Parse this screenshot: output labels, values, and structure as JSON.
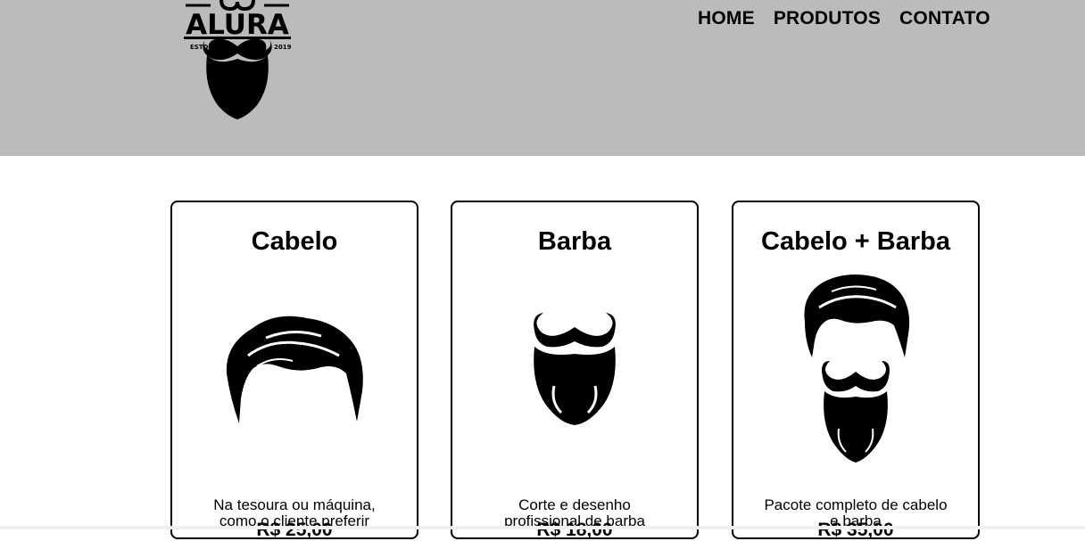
{
  "header": {
    "logo": {
      "brand": "ALURA",
      "estd_label": "ESTD",
      "year": "2019",
      "icon": "mustache-beard-logo-icon"
    },
    "nav": [
      {
        "label": "HOME"
      },
      {
        "label": "PRODUTOS"
      },
      {
        "label": "CONTATO"
      }
    ]
  },
  "products": [
    {
      "title": "Cabelo",
      "icon": "hair-icon",
      "description": "Na tesoura ou máquina, como o cliente preferir",
      "price": "R$ 25,00"
    },
    {
      "title": "Barba",
      "icon": "beard-icon",
      "description": "Corte e desenho profissional de barba",
      "price": "R$ 18,00"
    },
    {
      "title": "Cabelo + Barba",
      "icon": "hair-and-beard-icon",
      "description": "Pacote completo de cabelo e barba",
      "price": "R$ 35,00"
    }
  ],
  "colors": {
    "header_bg": "#bbbbbb",
    "page_bg": "#ffffff",
    "ink": "#000000"
  }
}
